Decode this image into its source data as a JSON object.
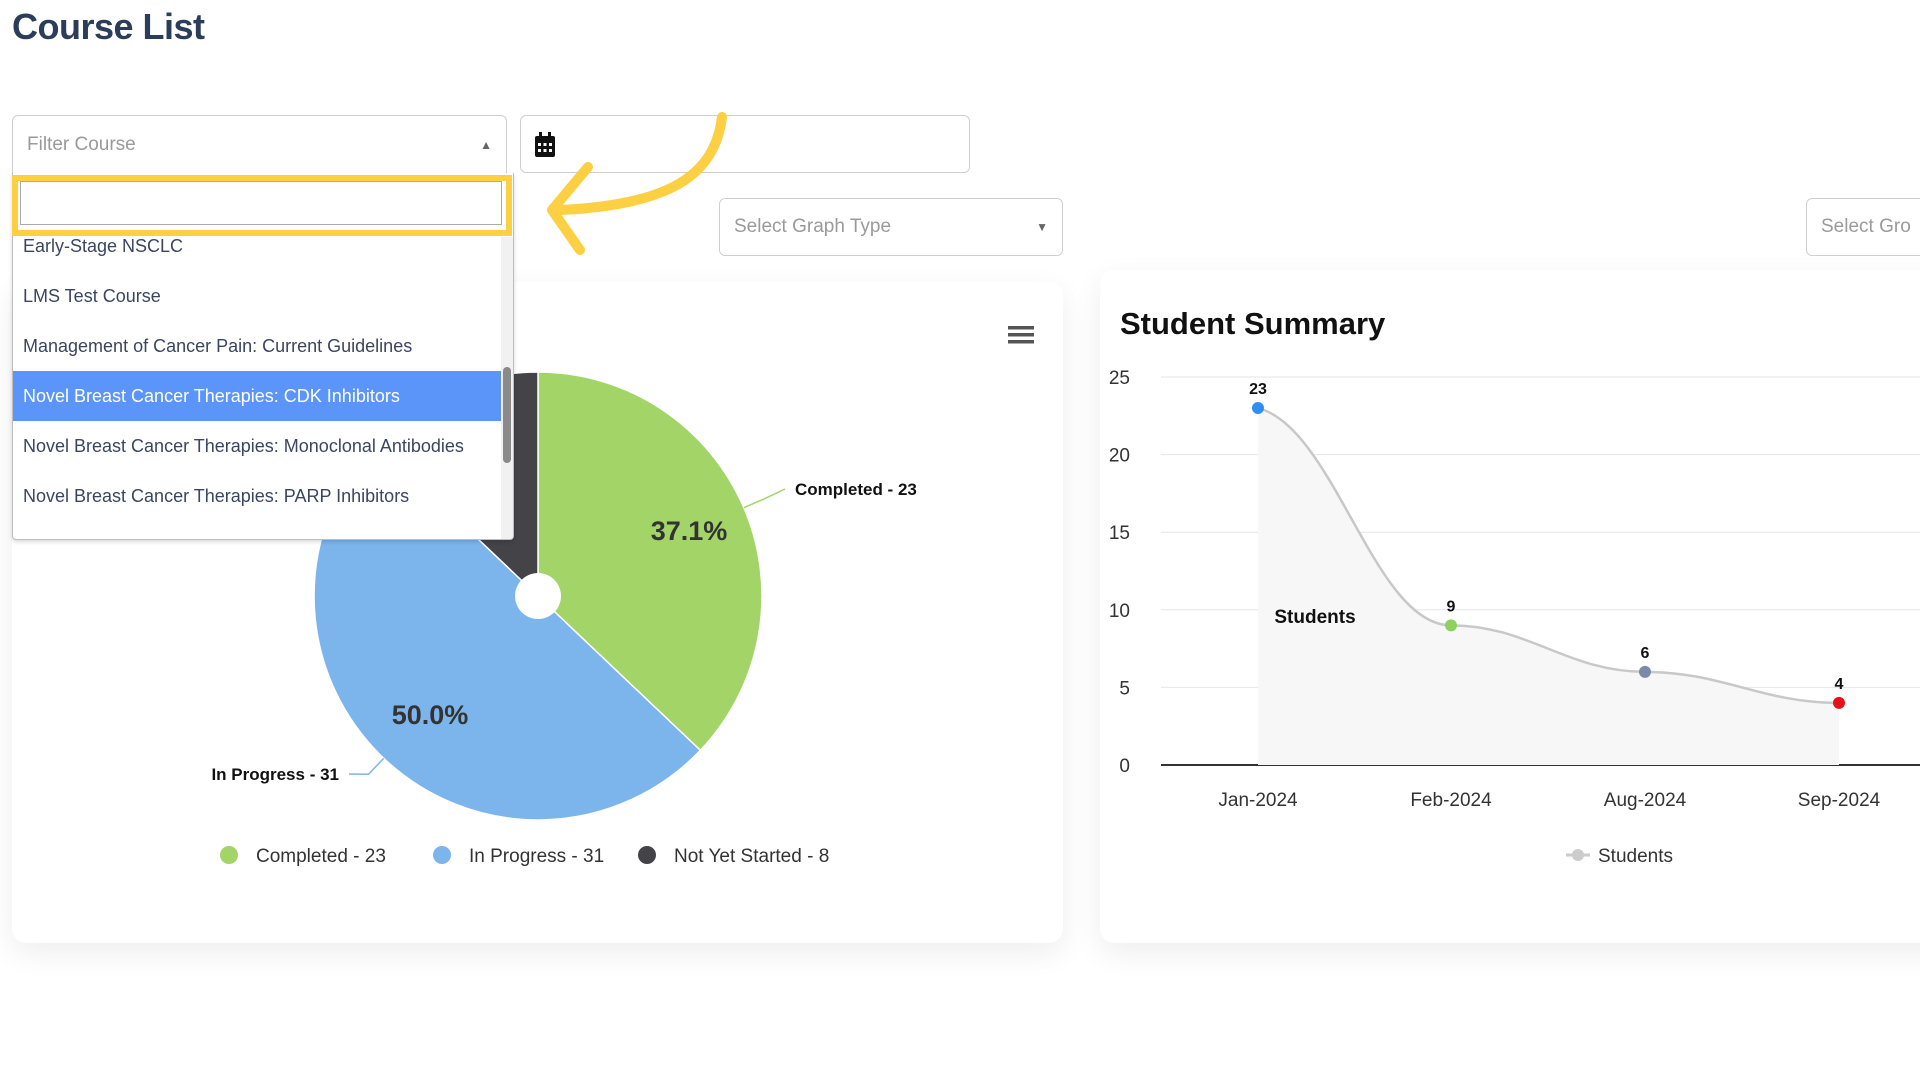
{
  "page": {
    "title": "Course List"
  },
  "filters": {
    "course_placeholder": "Filter Course",
    "search_value": "",
    "course_options": [
      "Leveraging the Growing Arsenal of Adjuvant Therapies for Early-Stage NSCLC",
      "LMS Test Course",
      "Management of Cancer Pain: Current Guidelines",
      "Novel Breast Cancer Therapies: CDK Inhibitors",
      "Novel Breast Cancer Therapies: Monoclonal Antibodies",
      "Novel Breast Cancer Therapies: PARP Inhibitors"
    ],
    "highlighted_option": "Novel Breast Cancer Therapies: CDK Inhibitors",
    "date_value": "",
    "graph_type_placeholder": "Select Graph Type",
    "group_placeholder": "Select Gro"
  },
  "colors": {
    "highlight": "#fdd043",
    "accent": "#5b95f9"
  },
  "chart_data": [
    {
      "type": "pie",
      "title": "",
      "slices": [
        {
          "name": "Completed",
          "value": 23,
          "percent": 37.1,
          "label": "Completed - 23",
          "pct_label": "37.1%",
          "color": "#a3d468"
        },
        {
          "name": "In Progress",
          "value": 31,
          "percent": 50.0,
          "label": "In Progress - 31",
          "pct_label": "50.0%",
          "color": "#7cb5ec"
        },
        {
          "name": "Not Yet Started",
          "value": 8,
          "percent": 12.9,
          "label": "Not Yet Started - 8",
          "pct_label": "",
          "color": "#434348"
        }
      ],
      "legend": [
        "Completed - 23",
        "In Progress - 31",
        "Not Yet Started - 8"
      ],
      "legend_placement": "bottom"
    },
    {
      "type": "area",
      "title": "Student Summary",
      "categories": [
        "Jan-2024",
        "Feb-2024",
        "Aug-2024",
        "Sep-2024"
      ],
      "series": [
        {
          "name": "Students",
          "values": [
            23,
            9,
            6,
            4
          ],
          "point_colors": [
            "#2f8ff0",
            "#90d060",
            "#7a8aa8",
            "#e8101a"
          ],
          "line_color": "#c8c8c8"
        }
      ],
      "ylim": [
        0,
        25
      ],
      "yticks": [
        0,
        5,
        10,
        15,
        20,
        25
      ],
      "grid": true,
      "annotation": "Students",
      "legend": [
        "Students"
      ],
      "legend_placement": "bottom"
    }
  ]
}
